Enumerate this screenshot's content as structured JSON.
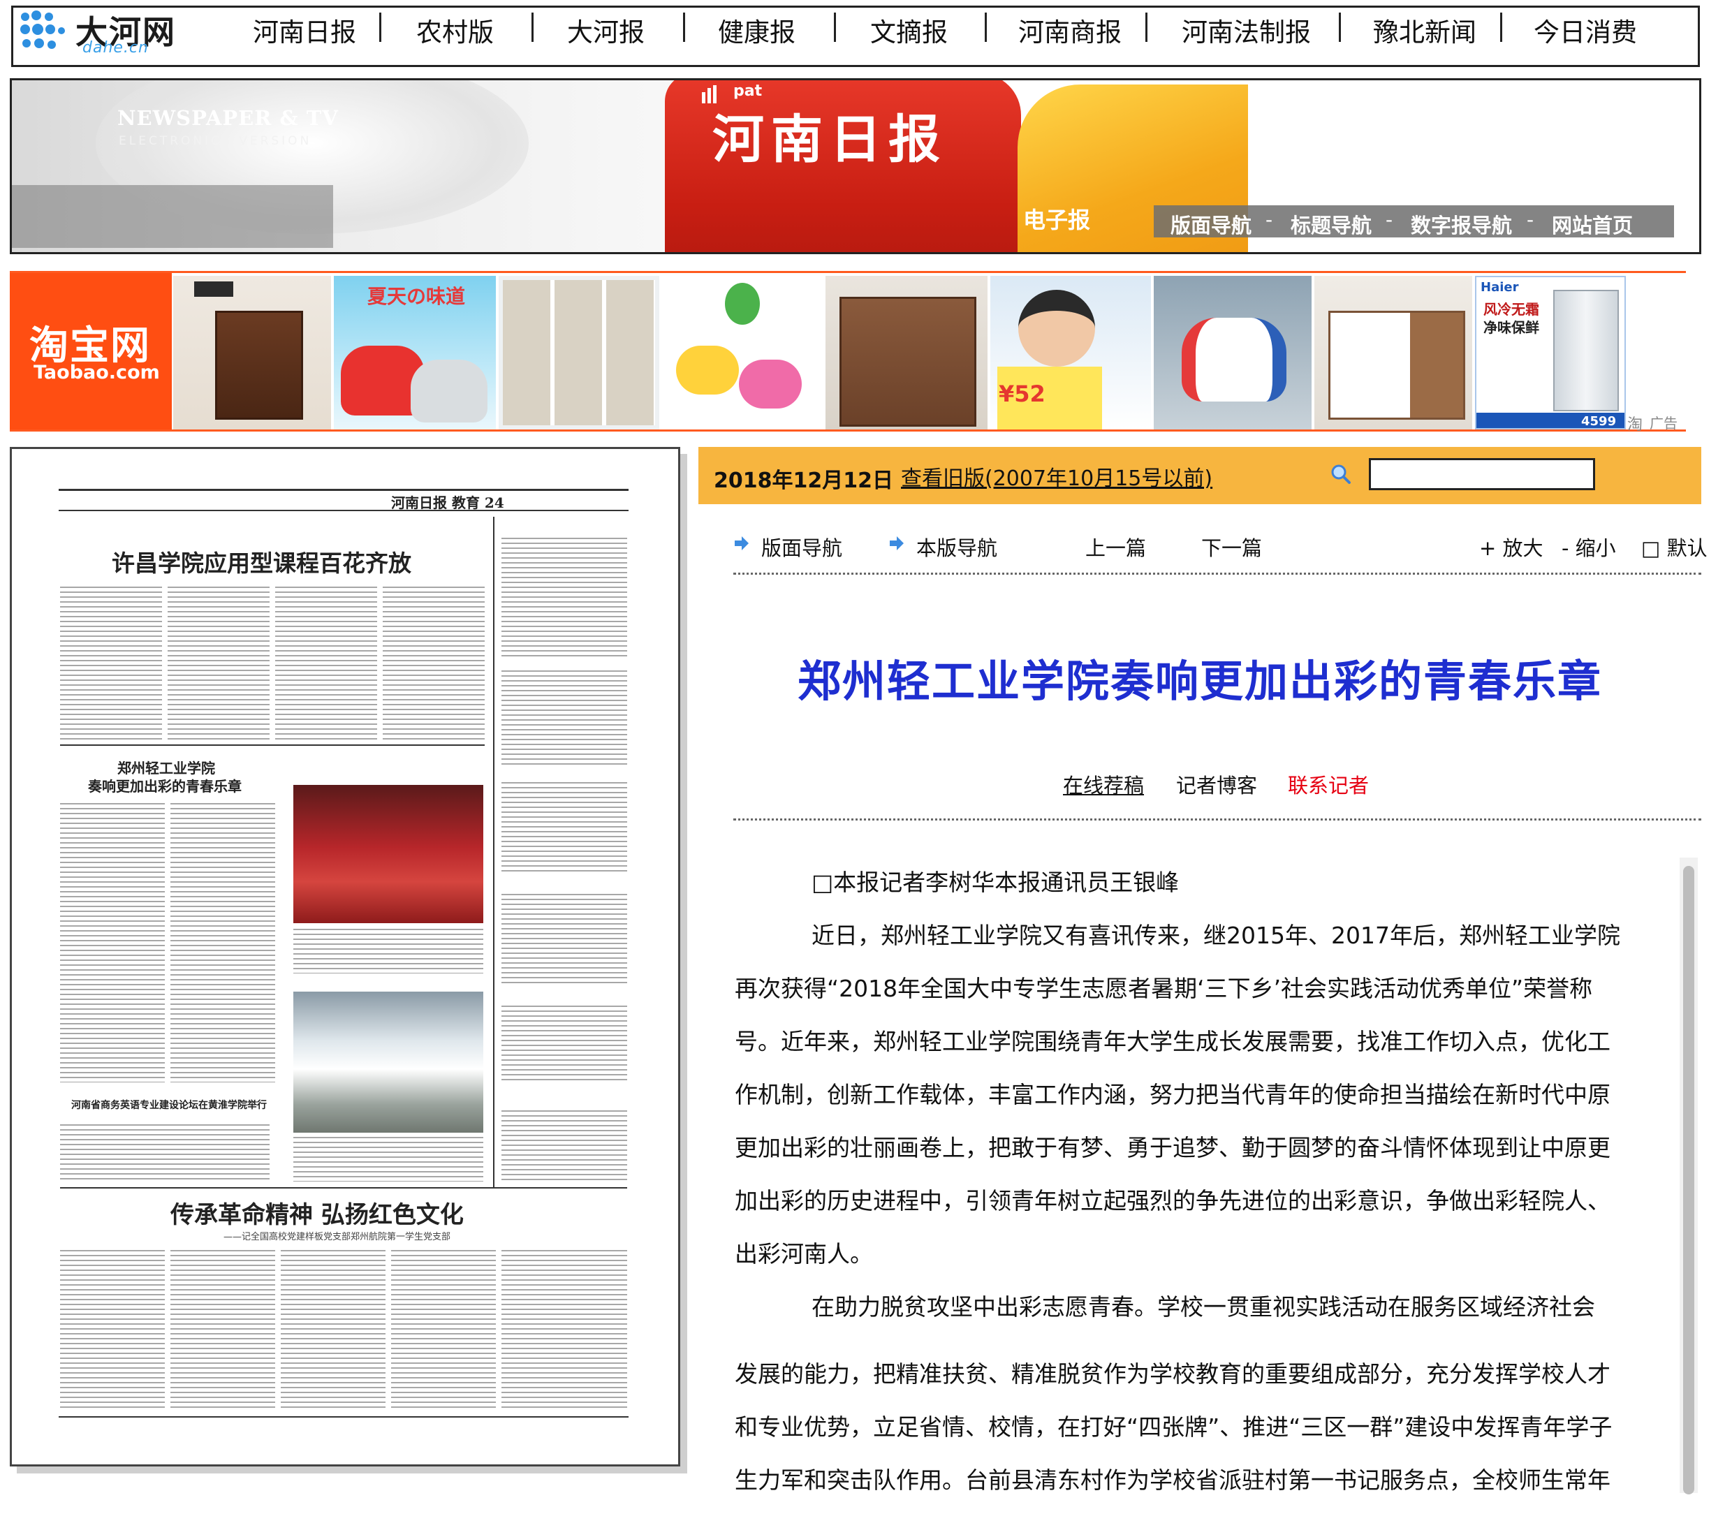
{
  "topnav": {
    "logo_text": "大河网",
    "logo_sub": "dahe.cn",
    "items": [
      "河南日报",
      "农村版",
      "大河报",
      "健康报",
      "文摘报",
      "河南商报",
      "河南法制报",
      "豫北新闻",
      "今日消费"
    ]
  },
  "banner": {
    "newspaper_tv": "NEWSPAPER & TV",
    "electronics_version": "ELECTRONICS VERSION",
    "red_top": "pat",
    "title": "河南日报",
    "subtitle": "电子报",
    "menu": [
      "版面导航",
      "标题导航",
      "数字报导航",
      "网站首页"
    ],
    "menu_sep": "-"
  },
  "ad": {
    "brand_cn": "淘宝网",
    "brand_en": "Taobao.com",
    "price_tag": "¥52",
    "shoe_tag": "夏天の味道",
    "fridge_brand": "Haier",
    "fridge_line1": "风冷无霜",
    "fridge_line2": "净味保鲜",
    "fridge_price": "4599",
    "label": "广告"
  },
  "paper": {
    "masthead": "河南日报  教育  24",
    "headline1": "许昌学院应用型课程百花齐放",
    "headline2a": "郑州轻工业学院",
    "headline2b": "奏响更加出彩的青春乐章",
    "headline3": "河南省商务英语专业建设论坛在黄淮学院举行",
    "headline4": "传承革命精神  弘扬红色文化",
    "subhead4": "——记全国高校党建样板党支部郑州航院第一学生党支部"
  },
  "article_bar": {
    "date": "2018年12月12日",
    "old_version": "查看旧版(2007年10月15号以前)",
    "search_placeholder": ""
  },
  "toolbar": {
    "page_nav": "版面导航",
    "this_page_nav": "本版导航",
    "prev": "上一篇",
    "next": "下一篇",
    "zoom_in": "+ 放大",
    "zoom_out": "- 缩小",
    "default": "□ 默认"
  },
  "article": {
    "title": "郑州轻工业学院奏响更加出彩的青春乐章",
    "links": {
      "submit": "在线荐稿",
      "blog": "记者博客",
      "contact": "联系记者"
    },
    "byline": "□本报记者李树华本报通讯员王银峰",
    "p1_l1": "近日，郑州轻工业学院又有喜讯传来，继2015年、2017年后，郑州轻工业学院",
    "p1_l2": "再次获得“2018年全国大中专学生志愿者暑期‘三下乡’社会实践活动优秀单位”荣誉称",
    "p1_l3": "号。近年来，郑州轻工业学院围绕青年大学生成长发展需要，找准工作切入点，优化工",
    "p1_l4": "作机制，创新工作载体，丰富工作内涵，努力把当代青年的使命担当描绘在新时代中原",
    "p1_l5": "更加出彩的壮丽画卷上，把敢于有梦、勇于追梦、勤于圆梦的奋斗情怀体现到让中原更",
    "p1_l6": "加出彩的历史进程中，引领青年树立起强烈的争先进位的出彩意识，争做出彩轻院人、",
    "p1_l7": "出彩河南人。",
    "p2_l1": "在助力脱贫攻坚中出彩志愿青春。学校一贯重视实践活动在服务区域经济社会",
    "p2_l2": "发展的能力，把精准扶贫、精准脱贫作为学校教育的重要组成部分，充分发挥学校人才",
    "p2_l3": "和专业优势，立足省情、校情，在打好“四张牌”、推进“三区一群”建设中发挥青年学子",
    "p2_l4": "生力军和突击队作用。台前县清东村作为学校省派驻村第一书记服务点，全校师生常年"
  },
  "colors": {
    "accent_orange": "#f7b53f",
    "title_blue": "#1e2ed0",
    "contact_red": "#e60012",
    "taobao_orange": "#ff4e12"
  }
}
